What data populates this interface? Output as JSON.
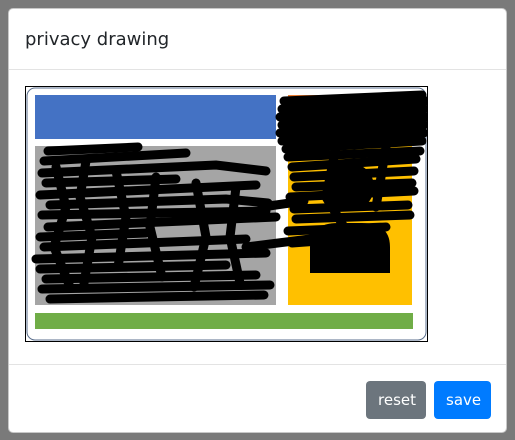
{
  "modal": {
    "title": "privacy drawing"
  },
  "footer": {
    "reset_label": "reset",
    "save_label": "save"
  },
  "colors": {
    "reset_button": "#6c757d",
    "save_button": "#007bff",
    "card_header_bar": "#4472c4",
    "card_photo_panel": "#ffc000",
    "card_orange_strip": "#ed7d31",
    "card_text_panel": "#a5a5a5",
    "card_footer_bar": "#70ad47",
    "redaction_scribble": "#000000"
  },
  "canvas": {
    "content": "id-card-template-with-redaction-scribbles"
  }
}
